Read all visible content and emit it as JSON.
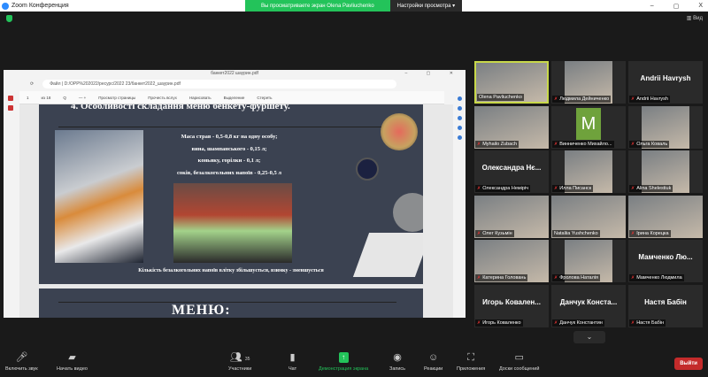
{
  "window": {
    "title": "Zoom Конференция",
    "minimize": "–",
    "maximize": "▢",
    "close": "X",
    "view_label": "Вид"
  },
  "banner": {
    "viewing": "Вы просматриваете экран Olena Pavliuchenko",
    "options": "Настройки просмотра ▾"
  },
  "browser": {
    "tab_title": "банкет2022 шаурин.pdf",
    "address_prefix": "Файл",
    "address": "D:/OPP%202022/ресурс/2022 23/банкет2022_шаурин.pdf",
    "pdf_toolbar": [
      "1",
      "из 18",
      "Q",
      "—  +",
      "Просмотр страницы",
      "Прочесть вслух",
      "Нарисовать",
      "Выделение",
      "Стереть"
    ]
  },
  "slide1": {
    "title": "4. Особливості складання меню бенкету-фуршету.",
    "lines": [
      "Маса страв - 0,5-0,8 кг на одну особу;",
      "вина, шампанського - 0,15 л;",
      "коньяку, горілки - 0,1 л;",
      "соків, безалкогольних напоїв - 0,25-0,5 л"
    ],
    "footer": "Кількість безалкогольних напоїв влітку збільшується, взимку - зменшується"
  },
  "slide2": {
    "title": "МЕНЮ:"
  },
  "participants": [
    {
      "name": "Olena Pavliuchenko",
      "video": true,
      "active": true,
      "muted": false
    },
    {
      "name": "Людмила Дейниченко",
      "video": true,
      "muted": true
    },
    {
      "name": "Andrii Havrysh",
      "display": "Andrii Havrysh",
      "muted": true
    },
    {
      "name": "Myhailo Zubach",
      "video": true,
      "muted": true
    },
    {
      "name": "Винниченко Михайло...",
      "avatar": "M",
      "muted": true
    },
    {
      "name": "Ольга Коваль",
      "video": true,
      "muted": true
    },
    {
      "name": "Олександра Немiрiч",
      "display": "Олександра Нє...",
      "muted": true
    },
    {
      "name": "Иллa Писанск",
      "video": true,
      "muted": true
    },
    {
      "name": "Alina Shelestiuk",
      "video": true,
      "muted": true
    },
    {
      "name": "Олег Кузьмін",
      "video": true,
      "muted": true
    },
    {
      "name": "Nataliia Yushchenko",
      "video": true,
      "muted": false
    },
    {
      "name": "Ірина Корецка",
      "video": true,
      "muted": true
    },
    {
      "name": "Катерина Головань",
      "video": true,
      "muted": true
    },
    {
      "name": "Фролова Наталія",
      "video": true,
      "muted": true
    },
    {
      "name": "Мамченко Людмила",
      "display": "Мамченко Лю...",
      "muted": true
    },
    {
      "name": "Игорь Коваленко",
      "display": "Игорь Ковален...",
      "muted": true
    },
    {
      "name": "Данчук Константин",
      "display": "Данчук Конста...",
      "muted": true
    },
    {
      "name": "Настя Бабін",
      "display": "Настя Бабін",
      "muted": true
    }
  ],
  "toolbar": {
    "audio": "Включить звук",
    "video": "Начать видео",
    "participants": "Участники",
    "participants_count": "35",
    "chat": "Чат",
    "share": "Демонстрация экрана",
    "record": "Запись",
    "reactions": "Реакции",
    "apps": "Приложения",
    "whiteboards": "Доски сообщений",
    "leave": "Выйти"
  },
  "colors": {
    "accent_green": "#23c35a",
    "leave_red": "#c42b2b",
    "active_speaker": "#c8d84a"
  }
}
